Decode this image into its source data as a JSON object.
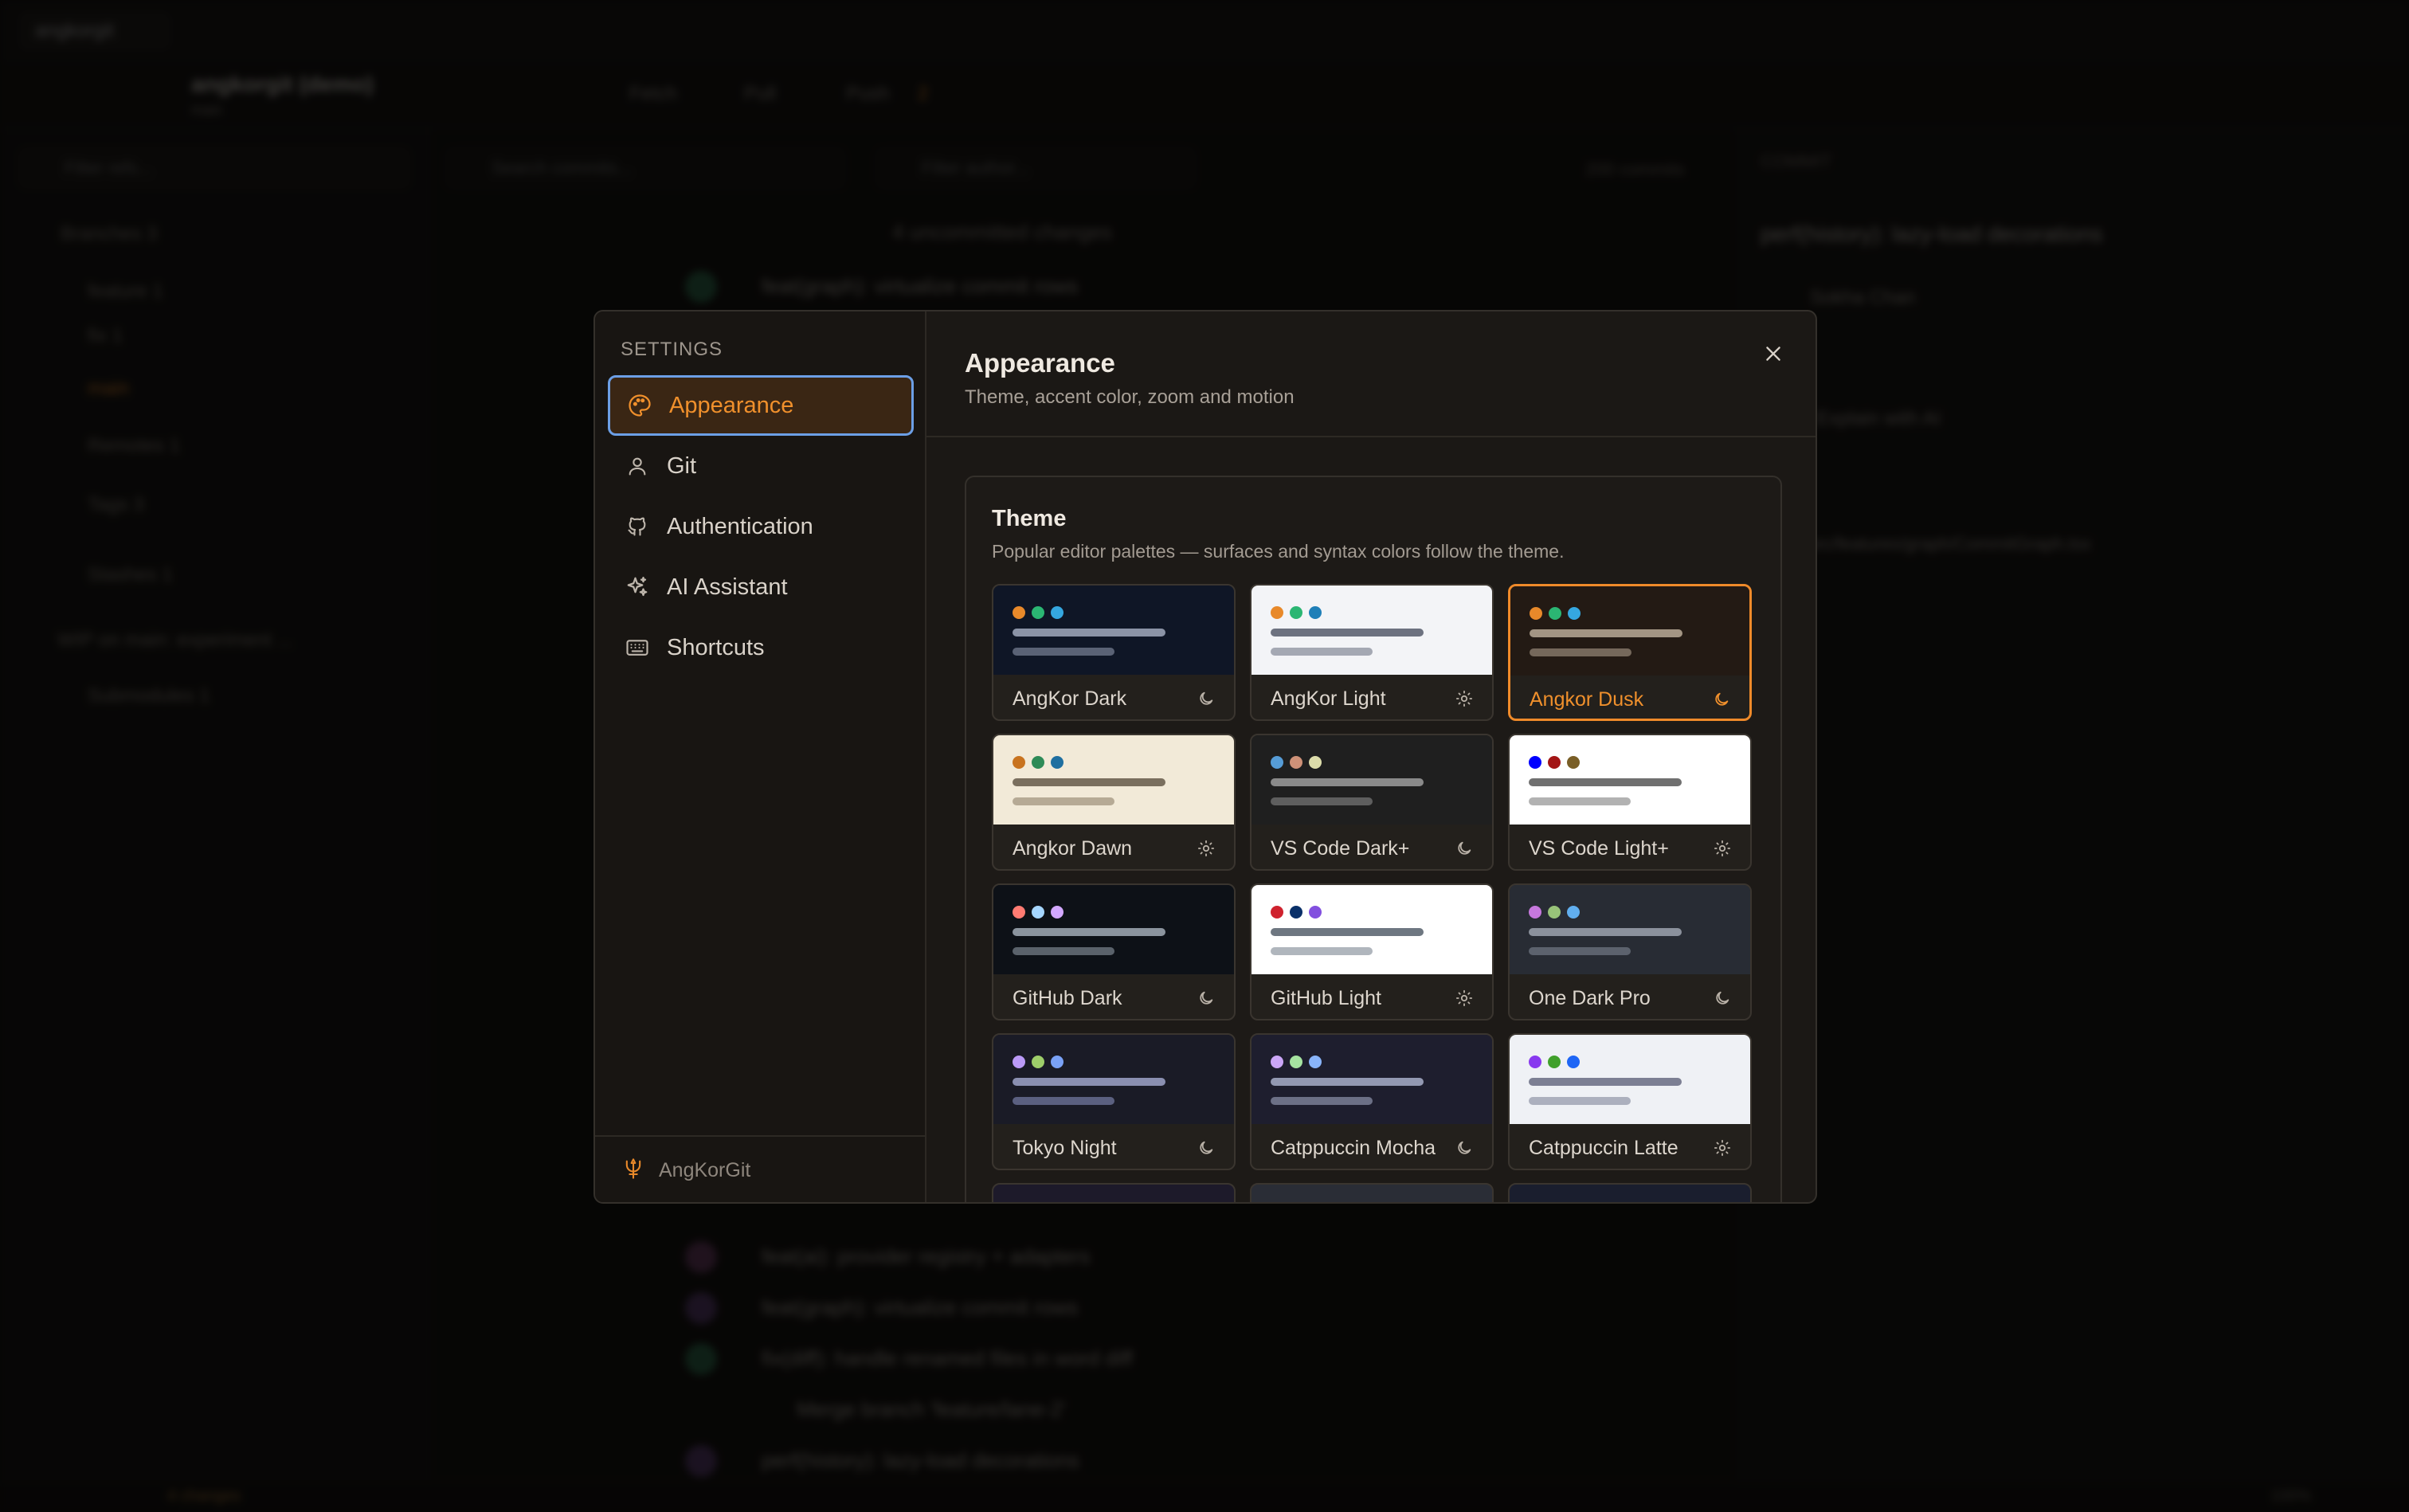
{
  "background_app": {
    "tab_label": "angkorgit",
    "repo_name": "angkorgit (demo)",
    "repo_sub": "main",
    "toolbar": {
      "fetch": "Fetch",
      "pull": "Pull",
      "push": "Push",
      "push_count": "2"
    },
    "sidebar_filter_placeholder": "Filter refs...",
    "search_placeholder": "Search commits...",
    "author_placeholder": "Filter author...",
    "commit_count": "200 commits",
    "sidebar_rows": [
      "Branches 3",
      "feature 1",
      "fix 1",
      "main",
      "Remotes 1",
      "Tags 3",
      "Stashes 1",
      "WIP on main: experiment ...",
      "Submodules 1"
    ],
    "uncommitted": "4 uncommitted changes",
    "commits": [
      "feat(graph): virtualize commit rows",
      "feat(ai): provider registry + adapters",
      "feat(graph): virtualize commit rows",
      "fix(diff): handle renamed files in word diff",
      "Merge branch 'feature/lane-2'",
      "perf(history): lazy-load decorations"
    ],
    "right_panel": {
      "header": "COMMIT",
      "title": "perf(history): lazy-load decorations",
      "author": "Sokha Chan",
      "explain": "Explain with AI",
      "file": "src/features/graph/CommitGraph.tsx"
    },
    "status": {
      "left": "4 changes",
      "right": "100%"
    }
  },
  "settings": {
    "heading": "SETTINGS",
    "nav": [
      {
        "label": "Appearance",
        "icon": "palette-icon",
        "active": true
      },
      {
        "label": "Git",
        "icon": "user-icon",
        "active": false
      },
      {
        "label": "Authentication",
        "icon": "github-icon",
        "active": false
      },
      {
        "label": "AI Assistant",
        "icon": "sparkles-icon",
        "active": false
      },
      {
        "label": "Shortcuts",
        "icon": "keyboard-icon",
        "active": false
      }
    ],
    "footer_label": "AngKorGit",
    "footer_icon": "trident-icon",
    "panel": {
      "title": "Appearance",
      "subtitle": "Theme, accent color, zoom and motion",
      "close_icon": "close-icon"
    },
    "theme": {
      "title": "Theme",
      "description": "Popular editor palettes — surfaces and syntax colors follow the theme.",
      "selected": "Angkor Dusk",
      "cards": [
        {
          "name": "AngKor Dark",
          "mode": "dark",
          "bg": "#0f1626",
          "dots": [
            "#e8892a",
            "#2bb673",
            "#35a7e0"
          ],
          "bar1": "#8b93a6",
          "bar2": "#5a6275"
        },
        {
          "name": "AngKor Light",
          "mode": "light",
          "bg": "#f3f4f7",
          "dots": [
            "#e8892a",
            "#2bb673",
            "#1f7fb8"
          ],
          "bar1": "#6d7280",
          "bar2": "#a4a8b3"
        },
        {
          "name": "Angkor Dusk",
          "mode": "dark",
          "bg": "#231a14",
          "dots": [
            "#e8892a",
            "#2bb673",
            "#35a7e0"
          ],
          "bar1": "#a39584",
          "bar2": "#75685b"
        },
        {
          "name": "Angkor Dawn",
          "mode": "light",
          "bg": "#f2ead8",
          "dots": [
            "#c8731f",
            "#2e8b57",
            "#1f6fa0"
          ],
          "bar1": "#7a6f5e",
          "bar2": "#b6aa95"
        },
        {
          "name": "VS Code Dark+",
          "mode": "dark",
          "bg": "#1f1f1f",
          "dots": [
            "#569cd6",
            "#ce9178",
            "#dcdcaa"
          ],
          "bar1": "#8a8a8a",
          "bar2": "#5e5e5e"
        },
        {
          "name": "VS Code Light+",
          "mode": "light",
          "bg": "#ffffff",
          "dots": [
            "#0000ff",
            "#a31515",
            "#795e26"
          ],
          "bar1": "#707070",
          "bar2": "#b2b2b2"
        },
        {
          "name": "GitHub Dark",
          "mode": "dark",
          "bg": "#0d1117",
          "dots": [
            "#ff7b72",
            "#a5d6ff",
            "#d2a8ff"
          ],
          "bar1": "#8b949e",
          "bar2": "#5a626b"
        },
        {
          "name": "GitHub Light",
          "mode": "light",
          "bg": "#ffffff",
          "dots": [
            "#cf222e",
            "#0a3069",
            "#8250df"
          ],
          "bar1": "#6e7781",
          "bar2": "#b0b6bd"
        },
        {
          "name": "One Dark Pro",
          "mode": "dark",
          "bg": "#282c34",
          "dots": [
            "#c678dd",
            "#98c379",
            "#61afef"
          ],
          "bar1": "#8b919c",
          "bar2": "#5c626d"
        },
        {
          "name": "Tokyo Night",
          "mode": "dark",
          "bg": "#1a1b26",
          "dots": [
            "#bb9af7",
            "#9ece6a",
            "#7aa2f7"
          ],
          "bar1": "#8a8fb0",
          "bar2": "#5b6080"
        },
        {
          "name": "Catppuccin Mocha",
          "mode": "dark",
          "bg": "#1e1e2e",
          "dots": [
            "#cba6f7",
            "#a6e3a1",
            "#89b4fa"
          ],
          "bar1": "#9399b2",
          "bar2": "#6c7086"
        },
        {
          "name": "Catppuccin Latte",
          "mode": "light",
          "bg": "#eff1f5",
          "dots": [
            "#8839ef",
            "#40a02b",
            "#1e66f5"
          ],
          "bar1": "#7c7f93",
          "bar2": "#acb0be"
        }
      ]
    }
  }
}
